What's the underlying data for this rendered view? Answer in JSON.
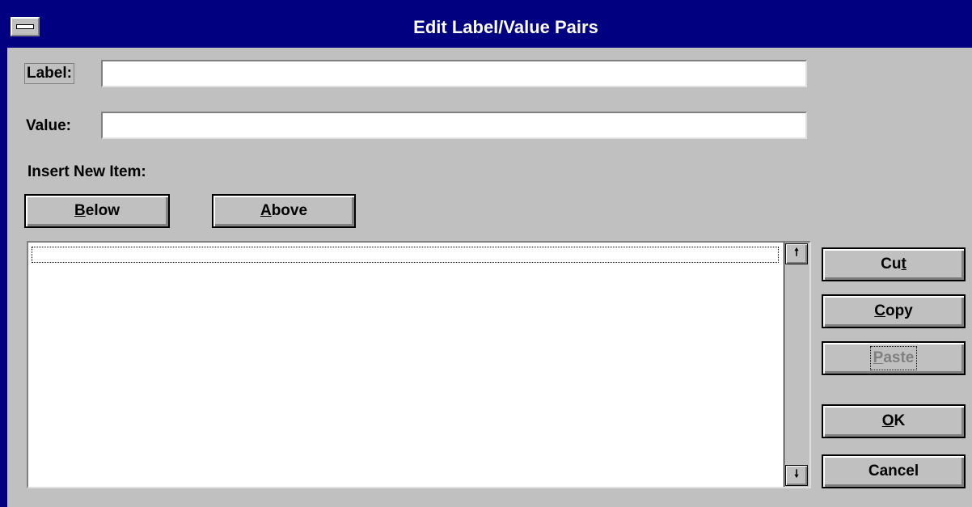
{
  "window": {
    "title": "Edit Label/Value Pairs"
  },
  "form": {
    "label_caption": "Label:",
    "label_value": "",
    "value_caption": "Value:",
    "value_value": "",
    "insert_caption": "Insert New Item:"
  },
  "buttons": {
    "below_accel": "B",
    "below_rest": "elow",
    "above_accel": "A",
    "above_rest": "bove",
    "cut_pre": "Cu",
    "cut_accel": "t",
    "copy_accel": "C",
    "copy_rest": "opy",
    "paste_accel": "P",
    "paste_rest": "aste",
    "ok_accel": "O",
    "ok_rest": "K",
    "cancel": "Cancel"
  },
  "list": {
    "items": [
      ""
    ],
    "scroll_up_icon": "arrow-up-icon",
    "scroll_down_icon": "arrow-down-icon"
  }
}
